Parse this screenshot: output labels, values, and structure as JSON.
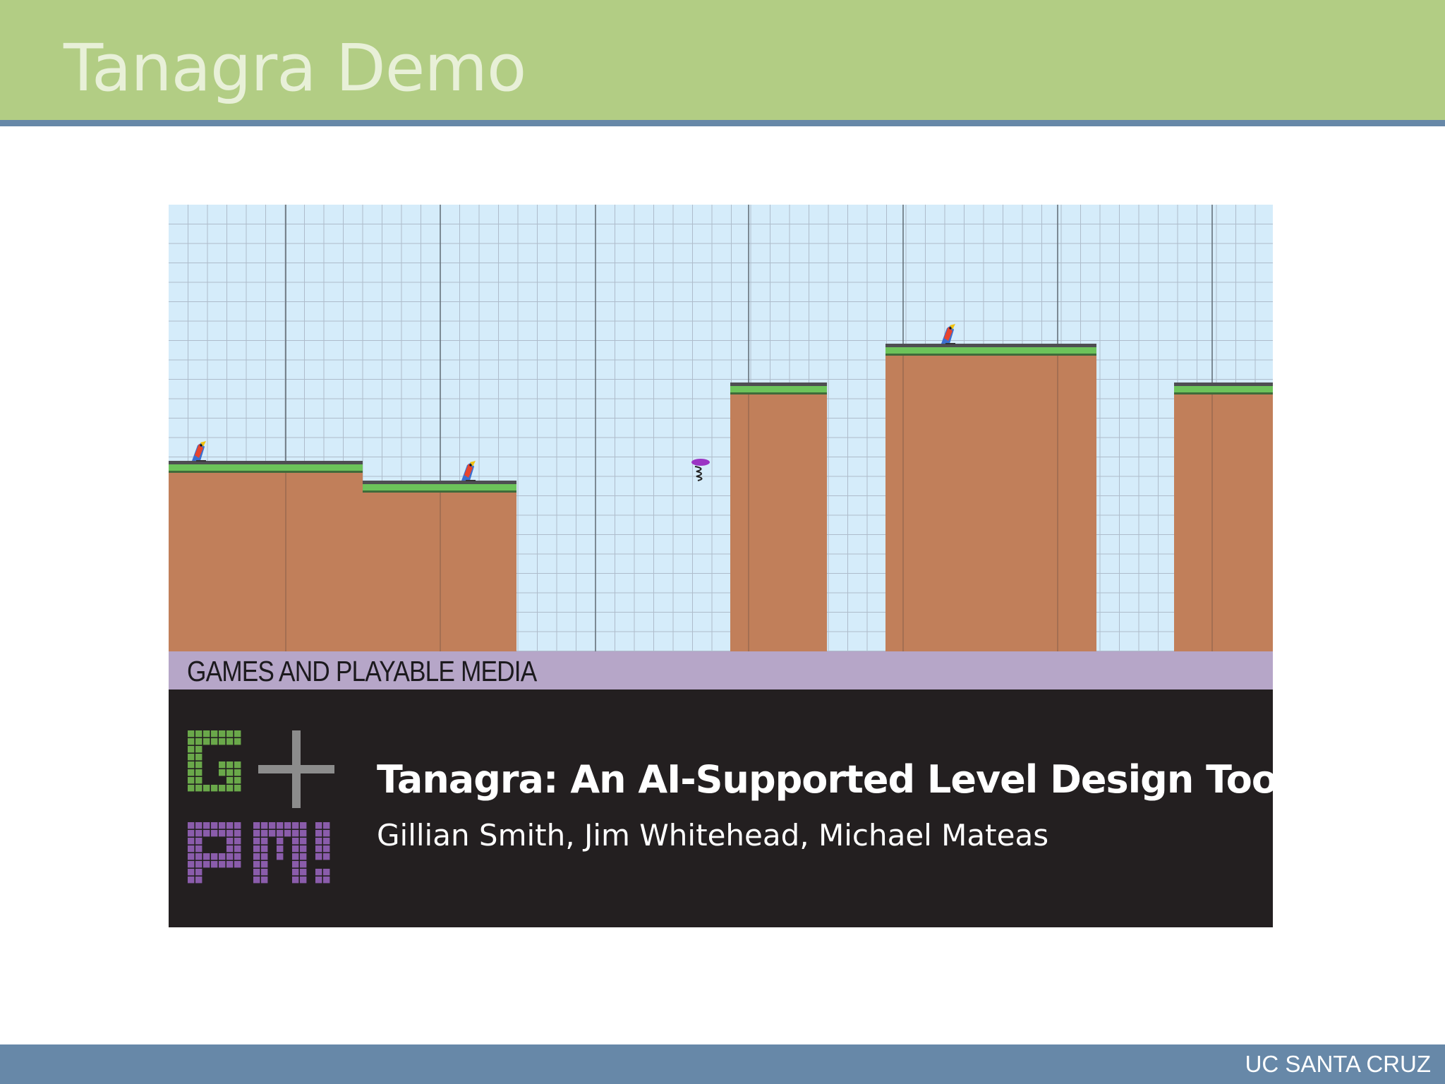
{
  "slide": {
    "title": "Tanagra Demo",
    "footer": "UC SANTA CRUZ"
  },
  "figure": {
    "band_label": "GAMES AND PLAYABLE MEDIA",
    "logo_letters": [
      "G",
      "+",
      "P",
      "M"
    ],
    "paper_title": "Tanagra: An AI-Supported Level Design Tool",
    "paper_authors": "Gillian Smith, Jim Whitehead, Michael Mateas"
  },
  "colors": {
    "header": "#b2cd84",
    "header_rule": "#6788a8",
    "footer": "#6788a8",
    "sky": "#d5ecfa",
    "ground": "#c17f5a",
    "grass": "#6cc35a",
    "band": "#b6a6c8",
    "panel": "#231f20",
    "logo_green": "#6aa84a",
    "logo_gray": "#8c8c8c",
    "logo_purple": "#8a5cab"
  },
  "level": {
    "sprites": [
      "bird-enemy-icon",
      "bird-enemy-icon",
      "spring-icon",
      "bird-enemy-icon"
    ]
  }
}
